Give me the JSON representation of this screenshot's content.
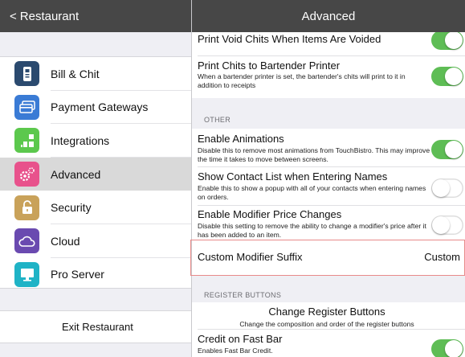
{
  "left_nav": {
    "back_label": "Restaurant"
  },
  "menu": [
    {
      "label": "Bill & Chit",
      "icon": "receipt-icon",
      "color": "#2b4a6f"
    },
    {
      "label": "Payment Gateways",
      "icon": "credit-card-icon",
      "color": "#3a7bd5"
    },
    {
      "label": "Integrations",
      "icon": "grid-icon",
      "color": "#5cc84d"
    },
    {
      "label": "Advanced",
      "icon": "gears-icon",
      "color": "#e8528c",
      "selected": true
    },
    {
      "label": "Security",
      "icon": "lock-icon",
      "color": "#c9a25a"
    },
    {
      "label": "Cloud",
      "icon": "cloud-icon",
      "color": "#6a4ab0"
    },
    {
      "label": "Pro Server",
      "icon": "monitor-icon",
      "color": "#1fb3c6"
    }
  ],
  "exit_label": "Exit Restaurant",
  "right_nav": {
    "title": "Advanced"
  },
  "settings": {
    "void_chits": {
      "title": "Print Void Chits When Items Are Voided",
      "on": true
    },
    "bartender": {
      "title": "Print Chits to Bartender Printer",
      "desc": "When a bartender printer is set, the bartender's chits will print to it in addition to receipts",
      "on": true
    },
    "other_header": "OTHER",
    "animations": {
      "title": "Enable Animations",
      "desc": "Disable this to remove most animations from TouchBistro. This may improve the time it takes to move between screens.",
      "on": true
    },
    "contact_list": {
      "title": "Show Contact List when Entering Names",
      "desc": "Enable this to show a popup with all of your contacts when entering names on orders.",
      "on": false
    },
    "modifier_price": {
      "title": "Enable Modifier Price Changes",
      "desc": "Disable this setting to remove the ability to change a modifier's price after it has been added to an item.",
      "on": false
    },
    "modifier_suffix": {
      "title": "Custom Modifier Suffix",
      "value": "Custom"
    },
    "register_header": "REGISTER BUTTONS",
    "register_buttons": {
      "title": "Change Register Buttons",
      "desc": "Change the composition and order of the register buttons"
    },
    "fast_bar": {
      "title": "Credit on Fast Bar",
      "desc": "Enables Fast Bar Credit.",
      "on": true
    }
  }
}
